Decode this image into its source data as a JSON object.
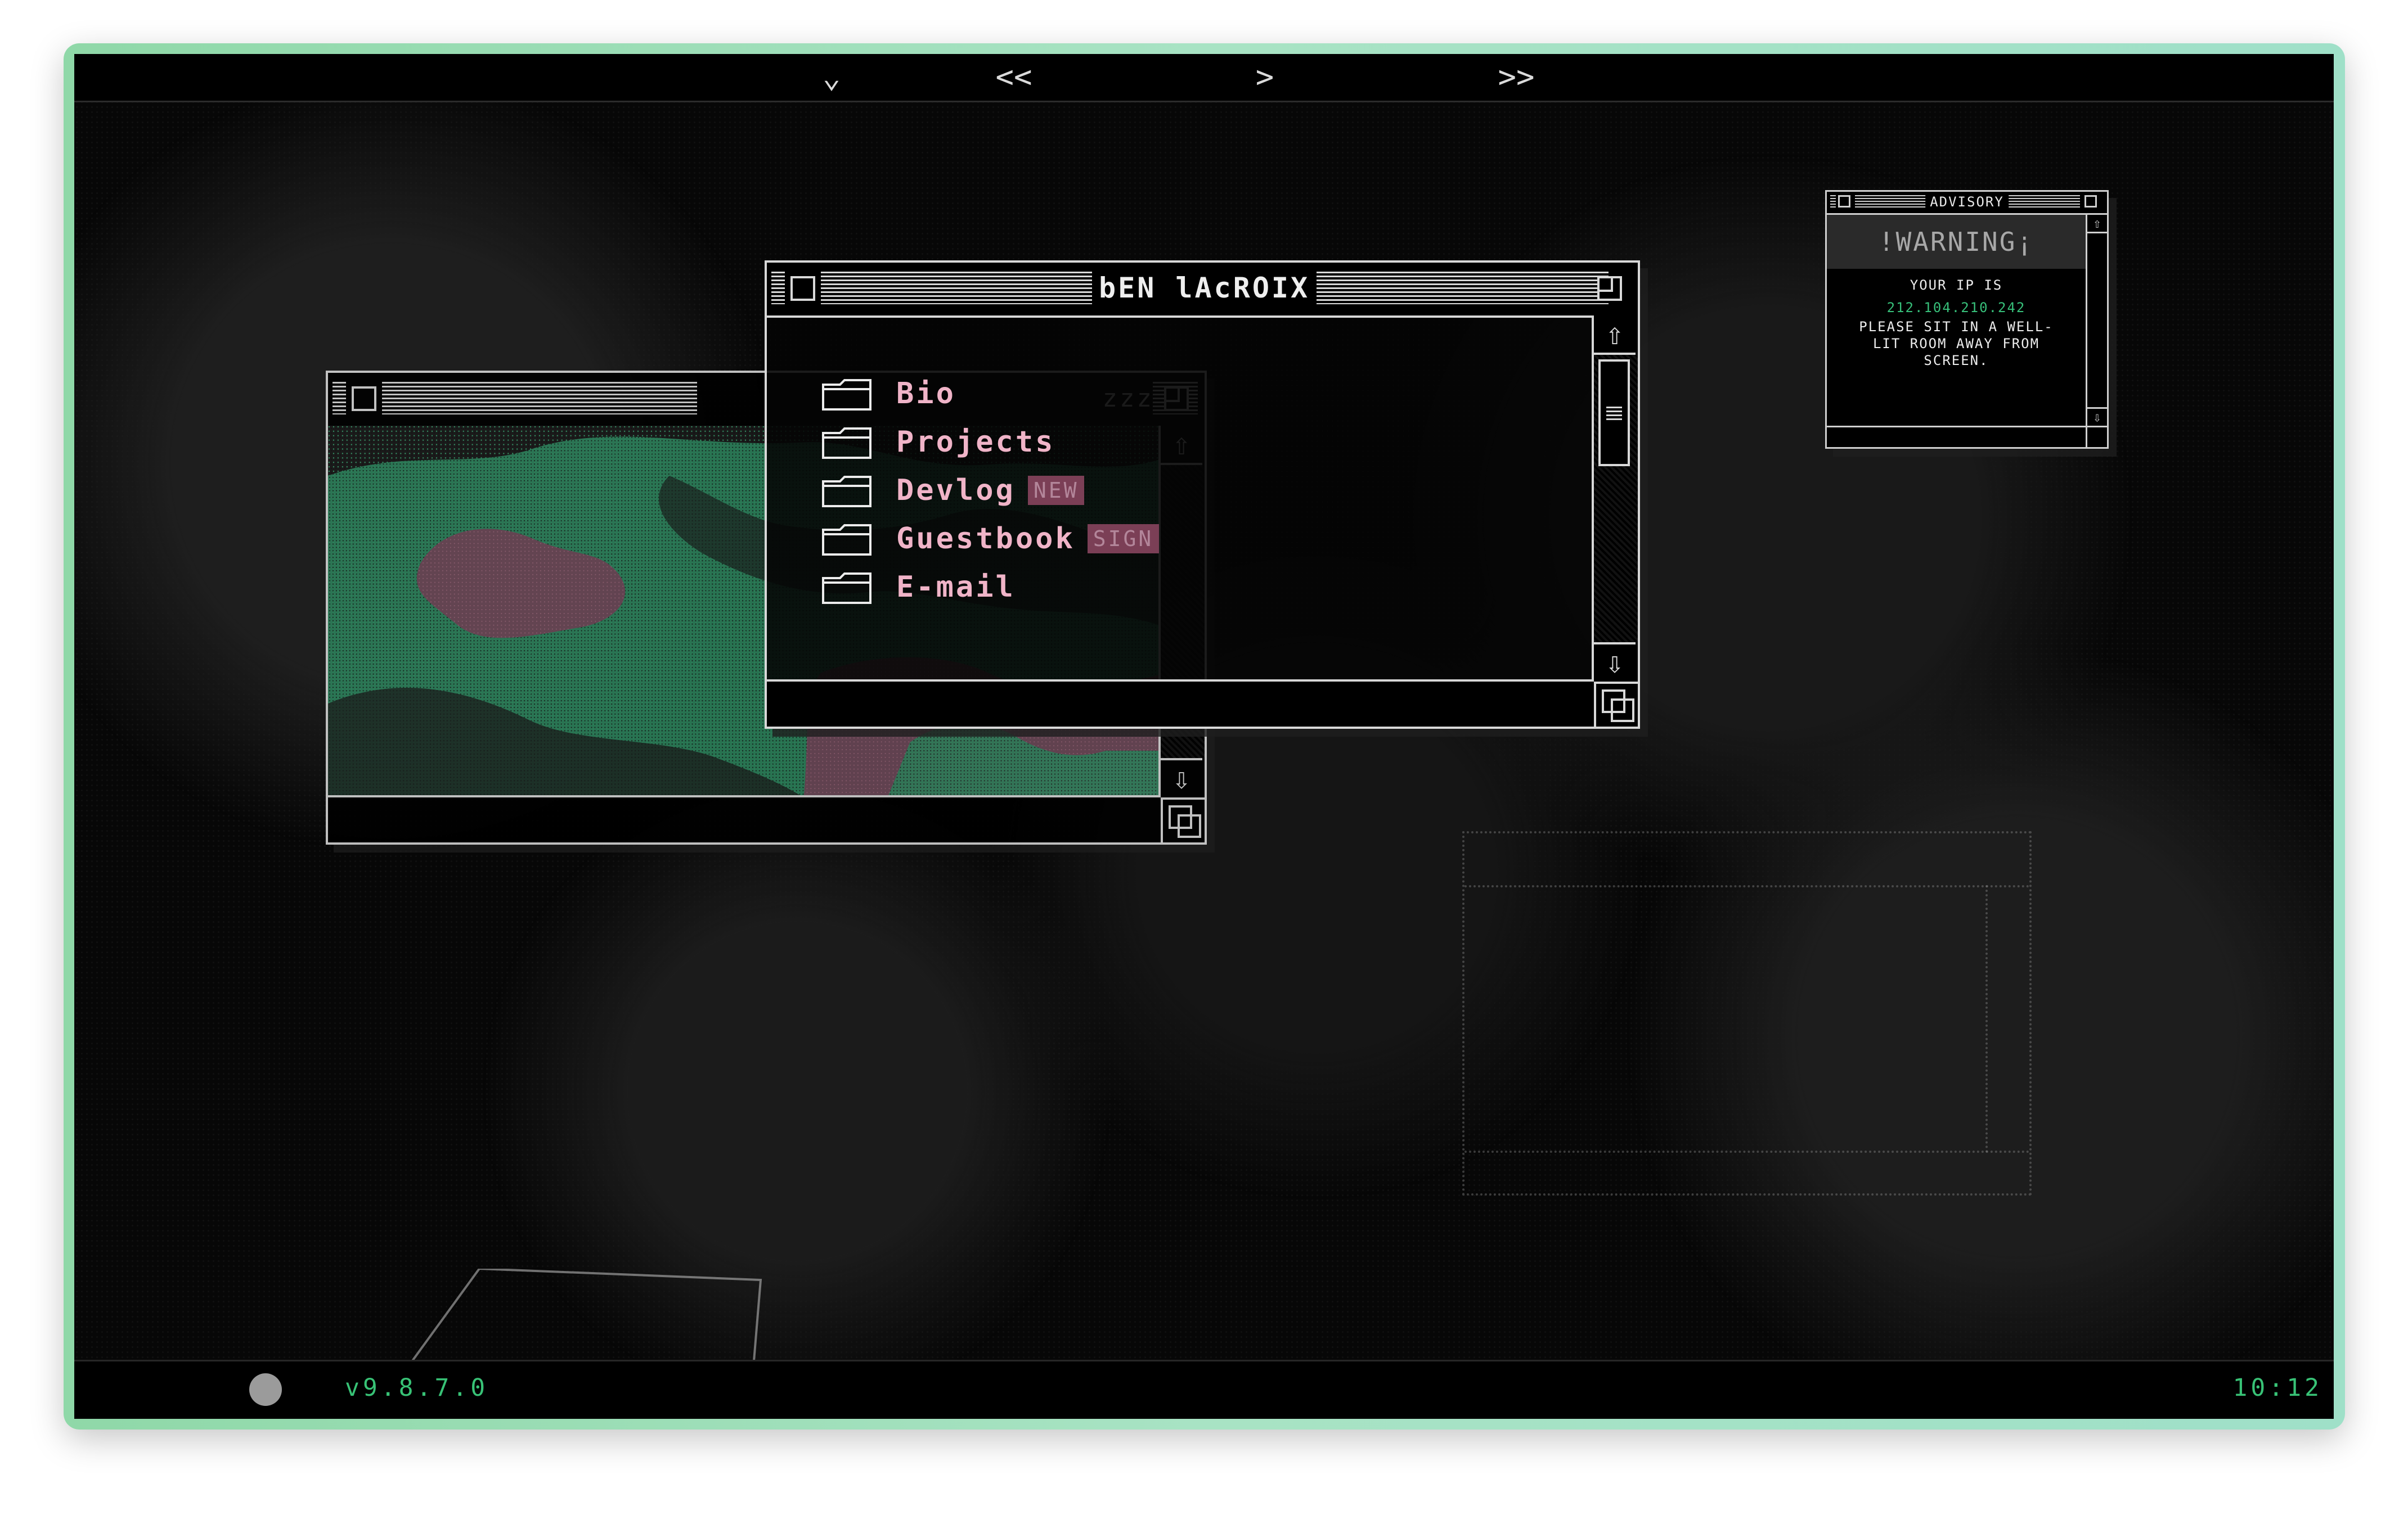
{
  "topNav": {
    "buttons": [
      {
        "name": "dropdown-button",
        "label": "⌄"
      },
      {
        "name": "first-button",
        "label": "<<"
      },
      {
        "name": "next-button",
        "label": ">"
      },
      {
        "name": "last-button",
        "label": ">>"
      }
    ]
  },
  "imageWindow": {
    "title": "zzz"
  },
  "mainWindow": {
    "title": "bEN lAcROIX",
    "folders": [
      {
        "label": "Bio",
        "badge": ""
      },
      {
        "label": "Projects",
        "badge": ""
      },
      {
        "label": "Devlog",
        "badge": "NEW"
      },
      {
        "label": "Guestbook",
        "badge": "SIGN"
      },
      {
        "label": "E-mail",
        "badge": ""
      }
    ]
  },
  "advisory": {
    "title": "ADVISORY",
    "warning": "!WARNING¡",
    "line1": "YOUR IP IS",
    "ip": "212.104.210.242",
    "line2": "PLEASE SIT IN A WELL-",
    "line3": "LIT ROOM AWAY FROM",
    "line4": "SCREEN."
  },
  "statusBar": {
    "version": "v9.8.7.0",
    "clock": "10:12"
  },
  "colors": {
    "accent": "#38c276",
    "folderText": "#f0b4c8",
    "badge": "#7b3f56",
    "frameGreen": "#8fd8a8"
  }
}
